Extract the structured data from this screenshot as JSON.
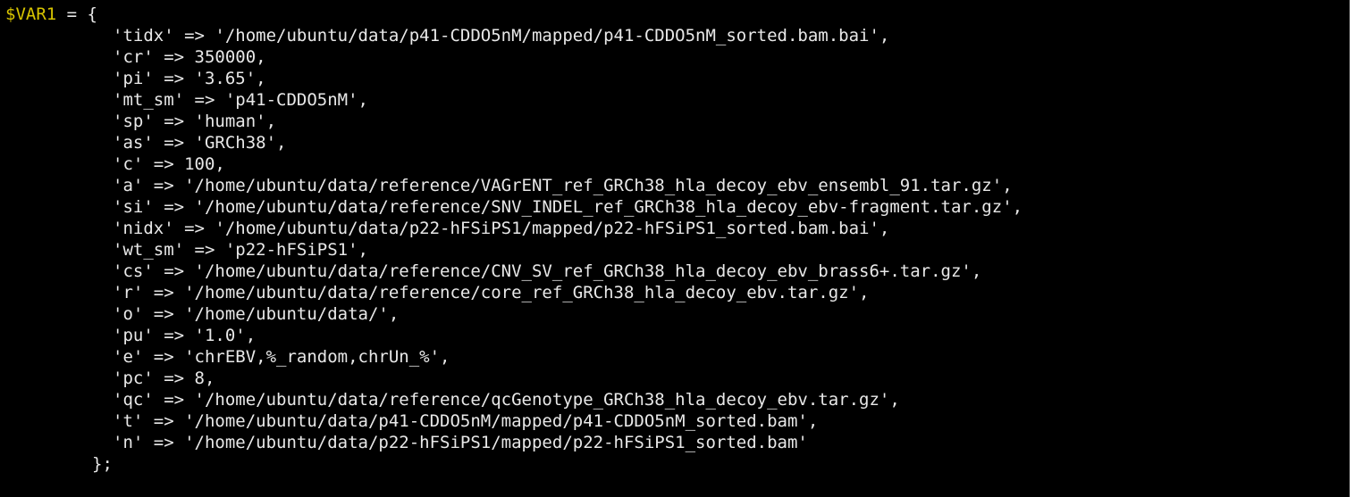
{
  "terminal": {
    "header": {
      "var": "$VAR1",
      "rest": " = {"
    },
    "entries": [
      "'tidx' => '/home/ubuntu/data/p41-CDDO5nM/mapped/p41-CDDO5nM_sorted.bam.bai',",
      "'cr' => 350000,",
      "'pi' => '3.65',",
      "'mt_sm' => 'p41-CDDO5nM',",
      "'sp' => 'human',",
      "'as' => 'GRCh38',",
      "'c' => 100,",
      "'a' => '/home/ubuntu/data/reference/VAGrENT_ref_GRCh38_hla_decoy_ebv_ensembl_91.tar.gz',",
      "'si' => '/home/ubuntu/data/reference/SNV_INDEL_ref_GRCh38_hla_decoy_ebv-fragment.tar.gz',",
      "'nidx' => '/home/ubuntu/data/p22-hFSiPS1/mapped/p22-hFSiPS1_sorted.bam.bai',",
      "'wt_sm' => 'p22-hFSiPS1',",
      "'cs' => '/home/ubuntu/data/reference/CNV_SV_ref_GRCh38_hla_decoy_ebv_brass6+.tar.gz',",
      "'r' => '/home/ubuntu/data/reference/core_ref_GRCh38_hla_decoy_ebv.tar.gz',",
      "'o' => '/home/ubuntu/data/',",
      "'pu' => '1.0',",
      "'e' => 'chrEBV,%_random,chrUn_%',",
      "'pc' => 8,",
      "'qc' => '/home/ubuntu/data/reference/qcGenotype_GRCh38_hla_decoy_ebv.tar.gz',",
      "'t' => '/home/ubuntu/data/p41-CDDO5nM/mapped/p41-CDDO5nM_sorted.bam',",
      "'n' => '/home/ubuntu/data/p22-hFSiPS1/mapped/p22-hFSiPS1_sorted.bam'"
    ],
    "footer": "};"
  },
  "colors": {
    "background": "#000000",
    "text": "#e8e8e8",
    "variable": "#d7c400",
    "scrollbar": "#ffffff"
  }
}
